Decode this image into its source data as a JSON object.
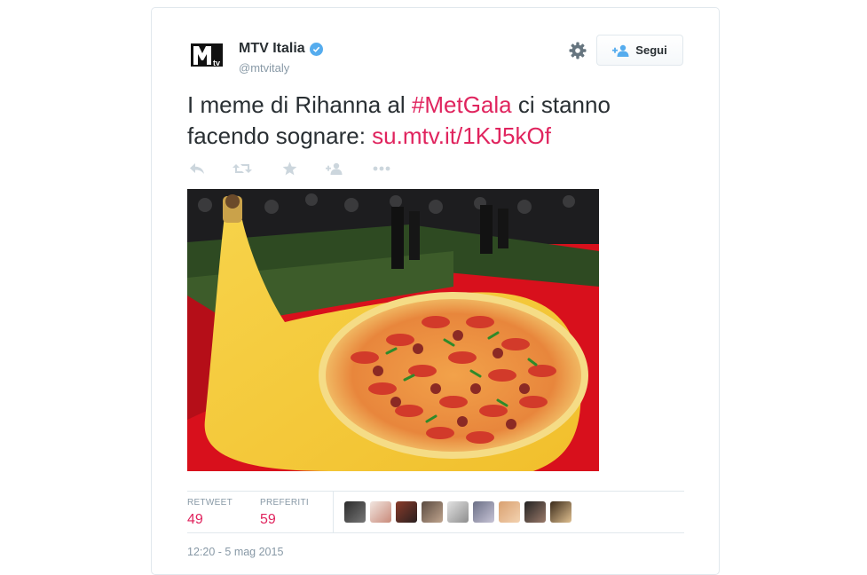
{
  "tweet": {
    "author_name": "MTV Italia",
    "handle": "@mtvitaly",
    "text_before": "I meme di Rihanna al ",
    "hashtag": "#MetGala",
    "text_middle": " ci stanno facendo sognare: ",
    "link": "su.mtv.it/1KJ5kOf",
    "timestamp": "12:20 - 5 mag 2015"
  },
  "follow": {
    "label": "Segui"
  },
  "stats": {
    "retweet_label": "RETWEET",
    "retweet_count": "49",
    "favorites_label": "PREFERITI",
    "favorites_count": "59"
  },
  "actions": [
    "reply-icon",
    "retweet-icon",
    "favorite-icon",
    "follow-user-icon",
    "more-icon"
  ],
  "colors": {
    "accent": "#e0245e",
    "verified": "#55acee",
    "muted": "#8899a6",
    "text": "#292f33",
    "border": "#e1e8ed"
  }
}
